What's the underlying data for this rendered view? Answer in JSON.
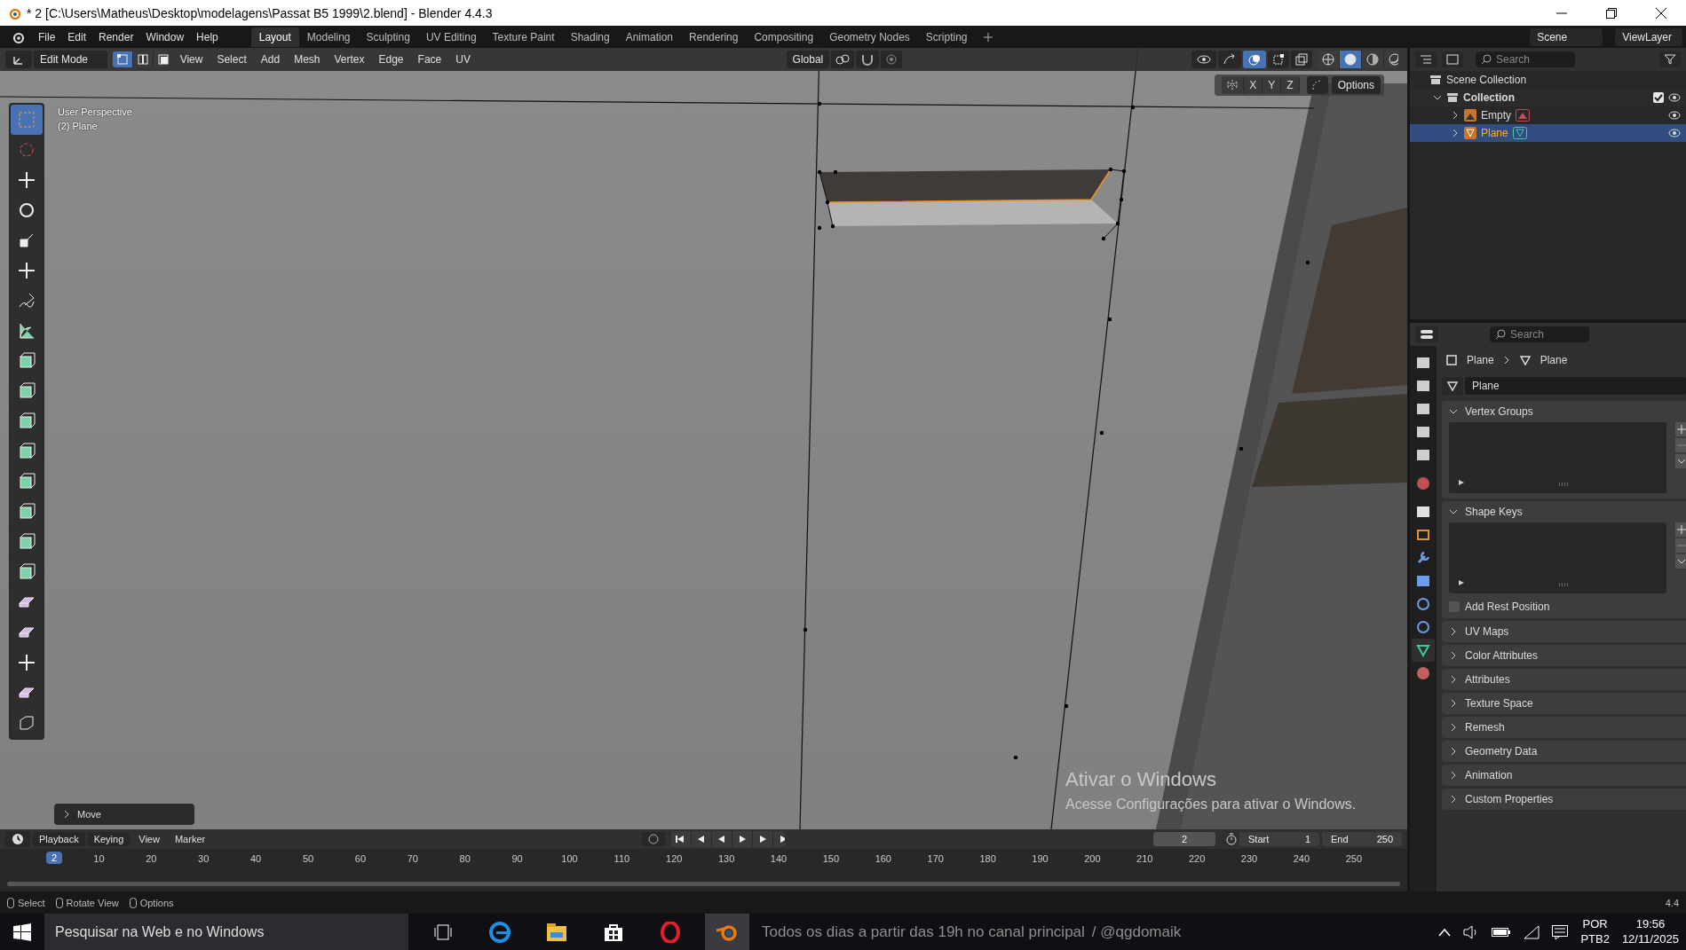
{
  "window": {
    "title": "* 2 [C:\\Users\\Matheus\\Desktop\\modelagens\\Passat B5 1999\\2.blend] - Blender 4.4.3"
  },
  "menus": [
    "File",
    "Edit",
    "Render",
    "Window",
    "Help"
  ],
  "workspaces": [
    {
      "label": "Layout",
      "selected": true
    },
    {
      "label": "Modeling",
      "selected": false
    },
    {
      "label": "Sculpting",
      "selected": false
    },
    {
      "label": "UV Editing",
      "selected": false
    },
    {
      "label": "Texture Paint",
      "selected": false
    },
    {
      "label": "Shading",
      "selected": false
    },
    {
      "label": "Animation",
      "selected": false
    },
    {
      "label": "Rendering",
      "selected": false
    },
    {
      "label": "Compositing",
      "selected": false
    },
    {
      "label": "Geometry Nodes",
      "selected": false
    },
    {
      "label": "Scripting",
      "selected": false
    }
  ],
  "scene": "Scene",
  "view_layer": "ViewLayer",
  "header": {
    "mode": "Edit Mode",
    "select_modes": [
      {
        "kind": "vertex",
        "selected": true
      },
      {
        "kind": "edge",
        "selected": false
      },
      {
        "kind": "face",
        "selected": false
      }
    ],
    "menus": [
      "View",
      "Select",
      "Add",
      "Mesh",
      "Vertex",
      "Edge",
      "Face",
      "UV"
    ],
    "orientation": "Global",
    "overlays_on": true,
    "shading": [
      {
        "kind": "wireframe",
        "selected": false
      },
      {
        "kind": "solid",
        "selected": true
      },
      {
        "kind": "material",
        "selected": false
      },
      {
        "kind": "rendered",
        "selected": false
      }
    ],
    "axes": [
      "X",
      "Y",
      "Z"
    ],
    "options": "Options"
  },
  "viewport": {
    "view_name": "User Perspective",
    "object_name": "(2) Plane",
    "last_operator": "Move"
  },
  "tools": [
    {
      "kind": "select-box",
      "selected": true
    },
    {
      "kind": "cursor",
      "selected": false
    },
    {
      "kind": "move",
      "selected": false
    },
    {
      "kind": "rotate",
      "selected": false
    },
    {
      "kind": "scale",
      "selected": false
    },
    {
      "kind": "transform",
      "selected": false
    },
    {
      "kind": "annotate",
      "selected": false
    },
    {
      "kind": "measure",
      "selected": false
    },
    {
      "kind": "add-cube",
      "selected": false
    },
    {
      "kind": "extrude",
      "selected": false
    },
    {
      "kind": "inset",
      "selected": false
    },
    {
      "kind": "bevel",
      "selected": false
    },
    {
      "kind": "loop-cut",
      "selected": false
    },
    {
      "kind": "knife",
      "selected": false
    },
    {
      "kind": "poly-build",
      "selected": false
    },
    {
      "kind": "spin",
      "selected": false
    },
    {
      "kind": "smooth",
      "selected": false
    },
    {
      "kind": "edge-slide",
      "selected": false
    },
    {
      "kind": "shrink",
      "selected": false
    },
    {
      "kind": "shear",
      "selected": false
    },
    {
      "kind": "rip",
      "selected": false
    }
  ],
  "outliner": {
    "search_placeholder": "Search",
    "root": "Scene Collection",
    "collection": {
      "label": "Collection",
      "expanded": true,
      "checked": true,
      "children": [
        {
          "label": "Empty",
          "kind": "empty",
          "selected": false
        },
        {
          "label": "Plane",
          "kind": "mesh",
          "selected": true
        }
      ]
    }
  },
  "properties": {
    "search_placeholder": "Search",
    "breadcrumb": [
      "Plane",
      "Plane"
    ],
    "data_name": "Plane",
    "tabs": [
      {
        "kind": "tool",
        "selected": false
      },
      {
        "kind": "render",
        "selected": false
      },
      {
        "kind": "output",
        "selected": false
      },
      {
        "kind": "view-layer",
        "selected": false
      },
      {
        "kind": "scene",
        "selected": false
      },
      {
        "kind": "world",
        "selected": false
      },
      {
        "kind": "collection",
        "selected": false
      },
      {
        "kind": "object",
        "selected": false
      },
      {
        "kind": "modifiers",
        "selected": false
      },
      {
        "kind": "particles",
        "selected": false
      },
      {
        "kind": "physics",
        "selected": false
      },
      {
        "kind": "constraints",
        "selected": false
      },
      {
        "kind": "data",
        "selected": true
      },
      {
        "kind": "material",
        "selected": false
      }
    ],
    "panels": [
      {
        "title": "Vertex Groups",
        "expanded": true,
        "kind": "list"
      },
      {
        "title": "Shape Keys",
        "expanded": true,
        "kind": "list",
        "checkbox": {
          "label": "Add Rest Position",
          "checked": false
        }
      },
      {
        "title": "UV Maps",
        "expanded": false
      },
      {
        "title": "Color Attributes",
        "expanded": false
      },
      {
        "title": "Attributes",
        "expanded": false
      },
      {
        "title": "Texture Space",
        "expanded": false
      },
      {
        "title": "Remesh",
        "expanded": false
      },
      {
        "title": "Geometry Data",
        "expanded": false
      },
      {
        "title": "Animation",
        "expanded": false
      },
      {
        "title": "Custom Properties",
        "expanded": false
      }
    ]
  },
  "timeline": {
    "menus": [
      "Playback",
      "Keying",
      "View",
      "Marker"
    ],
    "current_frame": "2",
    "playhead_frame": "2",
    "start_label": "Start",
    "start": "1",
    "end_label": "End",
    "end": "250",
    "ticks": [
      "10",
      "20",
      "30",
      "40",
      "50",
      "60",
      "70",
      "80",
      "90",
      "100",
      "110",
      "120",
      "130",
      "140",
      "150",
      "160",
      "170",
      "180",
      "190",
      "200",
      "210",
      "220",
      "230",
      "240",
      "250"
    ]
  },
  "status_bar": {
    "hints": [
      "Select",
      "Rotate View",
      "Options"
    ],
    "version": "4.4"
  },
  "watermark": {
    "title": "Ativar o Windows",
    "text": "Acesse Configurações para ativar o Windows."
  },
  "taskbar": {
    "search_placeholder": "Pesquisar na Web e no Windows",
    "ticker": "Todos os dias a partir das 19h no canal principal",
    "handle": "/ @qgdomaik",
    "language": "POR",
    "layout": "PTB2",
    "time": "19:56",
    "date": "12/11/2025"
  }
}
